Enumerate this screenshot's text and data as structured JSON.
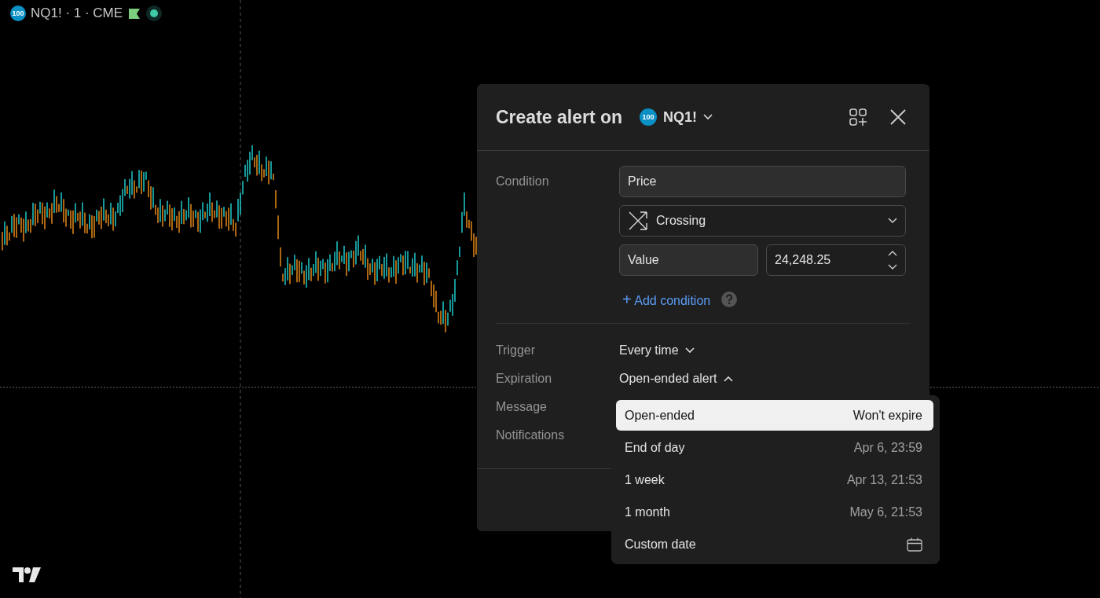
{
  "legend": {
    "badge": "100",
    "title": "NQ1! · 1 · CME"
  },
  "dialog": {
    "title": "Create alert on",
    "symbol_badge": "100",
    "symbol": "NQ1!",
    "condition": {
      "label": "Condition",
      "source": "Price",
      "operator": "Crossing",
      "target": "Value",
      "value": "24,248.25",
      "add_link": "Add condition",
      "add_icon": "+"
    },
    "settings": [
      {
        "label": "Trigger",
        "value": "Every time",
        "expanded": false
      },
      {
        "label": "Expiration",
        "value": "Open-ended alert",
        "expanded": true
      },
      {
        "label": "Message"
      },
      {
        "label": "Notifications"
      }
    ]
  },
  "expiration_menu": [
    {
      "label": "Open-ended",
      "detail": "Won't expire",
      "selected": true,
      "kind": "text"
    },
    {
      "label": "End of day",
      "detail": "Apr 6, 23:59",
      "selected": false,
      "kind": "text"
    },
    {
      "label": "1 week",
      "detail": "Apr 13, 21:53",
      "selected": false,
      "kind": "text"
    },
    {
      "label": "1 month",
      "detail": "May 6, 21:53",
      "selected": false,
      "kind": "text"
    },
    {
      "label": "Custom date",
      "selected": false,
      "kind": "calendar"
    }
  ]
}
